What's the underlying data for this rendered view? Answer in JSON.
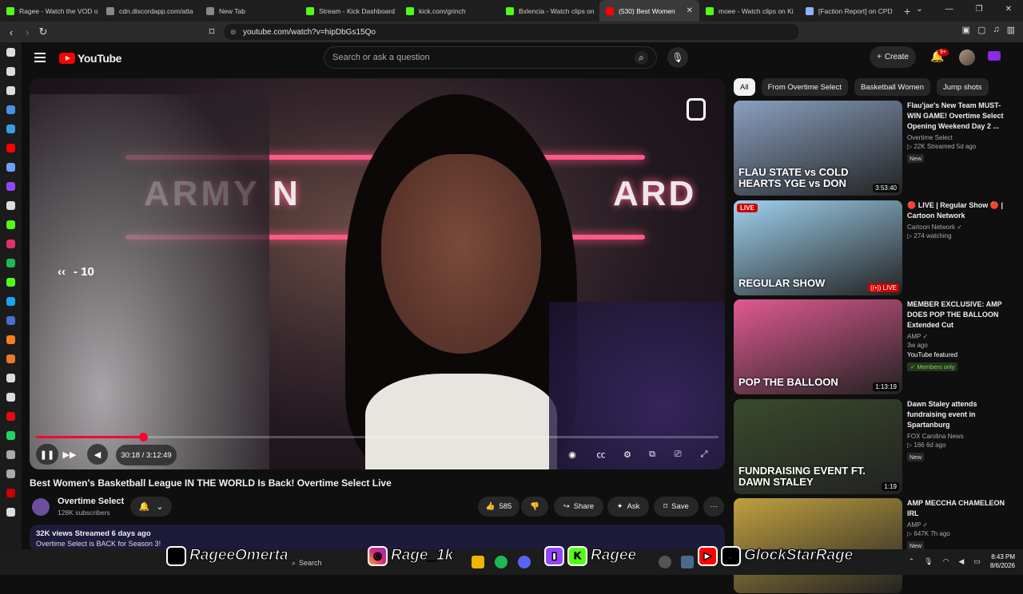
{
  "browser": {
    "tabs": [
      {
        "title": "Ragee - Watch the VOD o",
        "color": "#53fc18"
      },
      {
        "title": "cdn.discordapp.com/atta",
        "color": "#888888"
      },
      {
        "title": "New Tab",
        "color": "#888888"
      },
      {
        "title": "Stream - Kick Dashboard",
        "color": "#53fc18"
      },
      {
        "title": "kick.com/grinch",
        "color": "#53fc18"
      },
      {
        "title": "Bxlencia - Watch clips on",
        "color": "#53fc18"
      },
      {
        "title": "(530) Best Women",
        "color": "#ff0000",
        "active": true
      },
      {
        "title": "moee - Watch clips on Ki",
        "color": "#53fc18"
      },
      {
        "title": "[Faction Report] on CPD",
        "color": "#8ab4f8"
      }
    ],
    "url": "youtube.com/watch?v=hipDbGs15Qo",
    "window_controls": [
      "⌄",
      "—",
      "❐",
      "✕"
    ]
  },
  "youtube": {
    "logo_text": "YouTube",
    "search_placeholder": "Search or ask a question",
    "create_label": "Create",
    "notif_count": "9+"
  },
  "player": {
    "seek_indicator": "- 10",
    "time": "30:18 / 3:12:49",
    "progress": 0.157
  },
  "video": {
    "title": "Best Women's Basketball League IN THE WORLD Is Back! Overtime Select Live",
    "channel": "Overtime Select",
    "subscribers": "128K subscribers",
    "likes": "585",
    "share_label": "Share",
    "ask_label": "Ask",
    "save_label": "Save",
    "desc_meta": "32K views  Streamed 6 days ago",
    "desc_text": "Overtime Select is BACK for Season 3!"
  },
  "chips": [
    "All",
    "From Overtime Select",
    "Basketball Women",
    "Jump shots"
  ],
  "recommendations": [
    {
      "title": "Flau'jae's New Team MUST-WIN GAME! Overtime Select Opening Weekend Day 2 ...",
      "channel": "Overtime Select",
      "meta": "▷ 22K  Streamed 5d ago",
      "badge": "New",
      "duration": "3:53:40",
      "thumb_text": "FLAU STATE vs COLD HEARTS   YGE vs DON",
      "color": "#8aa0c0"
    },
    {
      "title": "🔴 LIVE | Regular Show 🔴 | Cartoon Network",
      "channel": "Cartoon Network ✓",
      "meta": "▷ 274 watching",
      "live": "LIVE",
      "duration": "((•)) LIVE",
      "thumb_text": "REGULAR SHOW",
      "color": "#9fd1ee"
    },
    {
      "title": "MEMBER EXCLUSIVE: AMP DOES POP THE BALLOON Extended Cut",
      "channel": "AMP ✓",
      "meta": "3w ago",
      "featured": "YouTube featured",
      "members": "✓ Members only",
      "duration": "1:13:19",
      "thumb_text": "POP THE BALLOON",
      "color": "#e05a90"
    },
    {
      "title": "Dawn Staley attends fundraising event in Spartanburg",
      "channel": "FOX Carolina News",
      "meta": "▷ 166  6d ago",
      "badge": "New",
      "duration": "1:19",
      "thumb_text": "FUNDRAISING EVENT FT. DAWN STALEY",
      "color": "#3a4a2a"
    },
    {
      "title": "AMP MECCHA CHAMELEON IRL",
      "channel": "AMP ✓",
      "meta": "▷ 647K  7h ago",
      "badge": "New",
      "duration": "",
      "thumb_text": "",
      "color": "#c0a040"
    }
  ],
  "overlay": {
    "x_handle": "RageeOmerta",
    "ig_handle": "Rage_1k",
    "kick_handle": "Ragee",
    "yt_handle": "GlockStarRage"
  },
  "taskbar": {
    "search": "Search",
    "time": "8:43 PM",
    "date": "8/6/2026"
  }
}
